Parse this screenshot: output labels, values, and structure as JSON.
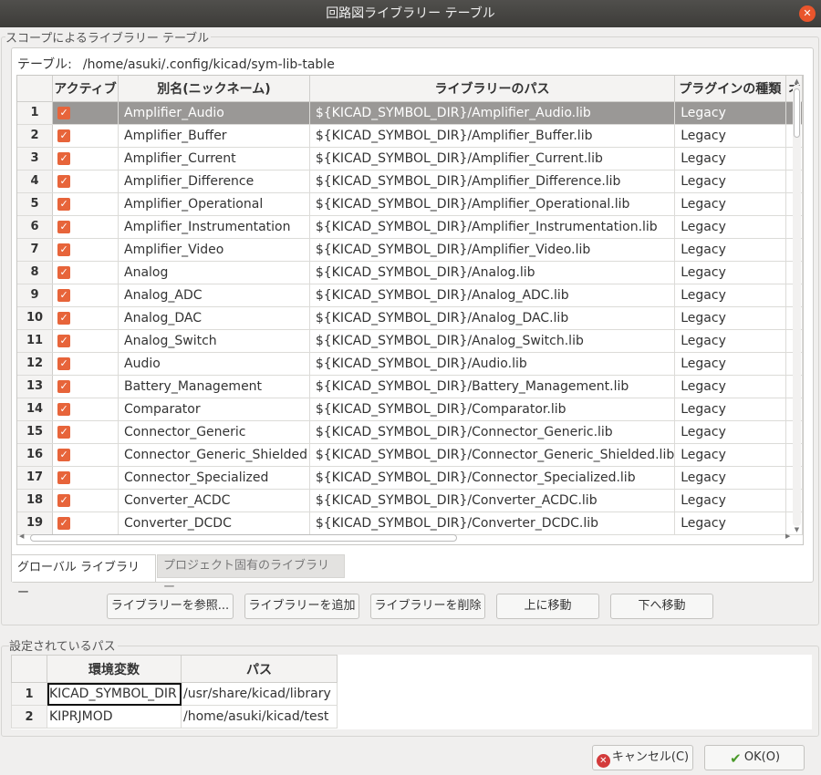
{
  "window": {
    "title": "回路図ライブラリー テーブル"
  },
  "scope_group": {
    "label": "スコープによるライブラリー テーブル"
  },
  "table_path": {
    "label": "テーブル:",
    "value": "/home/asuki/.config/kicad/sym-lib-table"
  },
  "columns": [
    "アクティブ",
    "別名(ニックネーム)",
    "ライブラリーのパス",
    "プラグインの種類",
    "オ"
  ],
  "rows": [
    {
      "num": "1",
      "name": "Amplifier_Audio",
      "path": "${KICAD_SYMBOL_DIR}/Amplifier_Audio.lib",
      "plugin": "Legacy"
    },
    {
      "num": "2",
      "name": "Amplifier_Buffer",
      "path": "${KICAD_SYMBOL_DIR}/Amplifier_Buffer.lib",
      "plugin": "Legacy"
    },
    {
      "num": "3",
      "name": "Amplifier_Current",
      "path": "${KICAD_SYMBOL_DIR}/Amplifier_Current.lib",
      "plugin": "Legacy"
    },
    {
      "num": "4",
      "name": "Amplifier_Difference",
      "path": "${KICAD_SYMBOL_DIR}/Amplifier_Difference.lib",
      "plugin": "Legacy"
    },
    {
      "num": "5",
      "name": "Amplifier_Operational",
      "path": "${KICAD_SYMBOL_DIR}/Amplifier_Operational.lib",
      "plugin": "Legacy"
    },
    {
      "num": "6",
      "name": "Amplifier_Instrumentation",
      "path": "${KICAD_SYMBOL_DIR}/Amplifier_Instrumentation.lib",
      "plugin": "Legacy"
    },
    {
      "num": "7",
      "name": "Amplifier_Video",
      "path": "${KICAD_SYMBOL_DIR}/Amplifier_Video.lib",
      "plugin": "Legacy"
    },
    {
      "num": "8",
      "name": "Analog",
      "path": "${KICAD_SYMBOL_DIR}/Analog.lib",
      "plugin": "Legacy"
    },
    {
      "num": "9",
      "name": "Analog_ADC",
      "path": "${KICAD_SYMBOL_DIR}/Analog_ADC.lib",
      "plugin": "Legacy"
    },
    {
      "num": "10",
      "name": "Analog_DAC",
      "path": "${KICAD_SYMBOL_DIR}/Analog_DAC.lib",
      "plugin": "Legacy"
    },
    {
      "num": "11",
      "name": "Analog_Switch",
      "path": "${KICAD_SYMBOL_DIR}/Analog_Switch.lib",
      "plugin": "Legacy"
    },
    {
      "num": "12",
      "name": "Audio",
      "path": "${KICAD_SYMBOL_DIR}/Audio.lib",
      "plugin": "Legacy"
    },
    {
      "num": "13",
      "name": "Battery_Management",
      "path": "${KICAD_SYMBOL_DIR}/Battery_Management.lib",
      "plugin": "Legacy"
    },
    {
      "num": "14",
      "name": "Comparator",
      "path": "${KICAD_SYMBOL_DIR}/Comparator.lib",
      "plugin": "Legacy"
    },
    {
      "num": "15",
      "name": "Connector_Generic",
      "path": "${KICAD_SYMBOL_DIR}/Connector_Generic.lib",
      "plugin": "Legacy"
    },
    {
      "num": "16",
      "name": "Connector_Generic_Shielded",
      "path": "${KICAD_SYMBOL_DIR}/Connector_Generic_Shielded.lib",
      "plugin": "Legacy"
    },
    {
      "num": "17",
      "name": "Connector_Specialized",
      "path": "${KICAD_SYMBOL_DIR}/Connector_Specialized.lib",
      "plugin": "Legacy"
    },
    {
      "num": "18",
      "name": "Converter_ACDC",
      "path": "${KICAD_SYMBOL_DIR}/Converter_ACDC.lib",
      "plugin": "Legacy"
    },
    {
      "num": "19",
      "name": "Converter_DCDC",
      "path": "${KICAD_SYMBOL_DIR}/Converter_DCDC.lib",
      "plugin": "Legacy"
    }
  ],
  "tabs": {
    "global": "グローバル ライブラリー",
    "project": "プロジェクト固有のライブラリー"
  },
  "buttons": {
    "browse": "ライブラリーを参照...",
    "add": "ライブラリーを追加",
    "remove": "ライブラリーを削除",
    "move_up": "上に移動",
    "move_down": "下へ移動",
    "cancel": "キャンセル(C)",
    "ok": "OK(O)"
  },
  "env": {
    "label": "設定されているパス",
    "columns": [
      "環境変数",
      "パス"
    ],
    "rows": [
      {
        "num": "1",
        "var": "KICAD_SYMBOL_DIR",
        "path": "/usr/share/kicad/library"
      },
      {
        "num": "2",
        "var": "KIPRJMOD",
        "path": "/home/asuki/kicad/test"
      }
    ]
  },
  "colors": {
    "checkbox": "#e7643a",
    "selected_row": "#9a9896",
    "close_button": "#e9552c"
  }
}
